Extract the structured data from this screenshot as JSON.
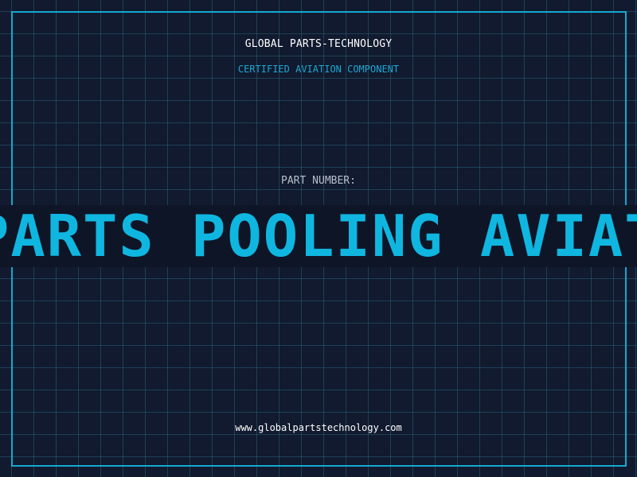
{
  "header": {
    "company": "GLOBAL PARTS-TECHNOLOGY",
    "subtitle": "CERTIFIED AVIATION COMPONENT"
  },
  "part": {
    "label": "PART NUMBER:",
    "value": "PARTS POOLING AVIATION"
  },
  "footer": {
    "website": "www.globalpartstechnology.com"
  },
  "colors": {
    "background": "#111a2e",
    "grid": "#285f78",
    "accent": "#16a8d0",
    "text": "#ffffff",
    "muted": "#b6c0cc"
  }
}
